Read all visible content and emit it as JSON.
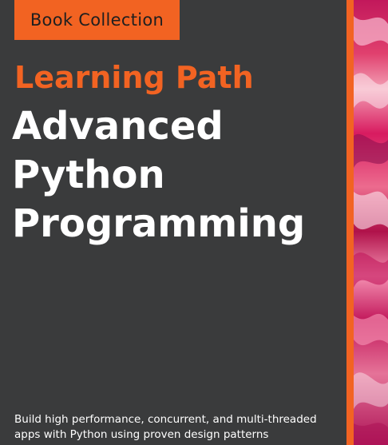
{
  "badge": {
    "label": "Book Collection"
  },
  "cover": {
    "series": "Learning Path",
    "title_lines": [
      "Advanced",
      "Python",
      "Programming"
    ],
    "tagline_lines": [
      "Build high performance, concurrent, and multi-threaded",
      "apps with Python using proven design patterns"
    ]
  },
  "colors": {
    "accent": "#f26322",
    "background": "#3a3b3c",
    "title_text": "#ffffff",
    "art_primary": "#d81b60"
  }
}
